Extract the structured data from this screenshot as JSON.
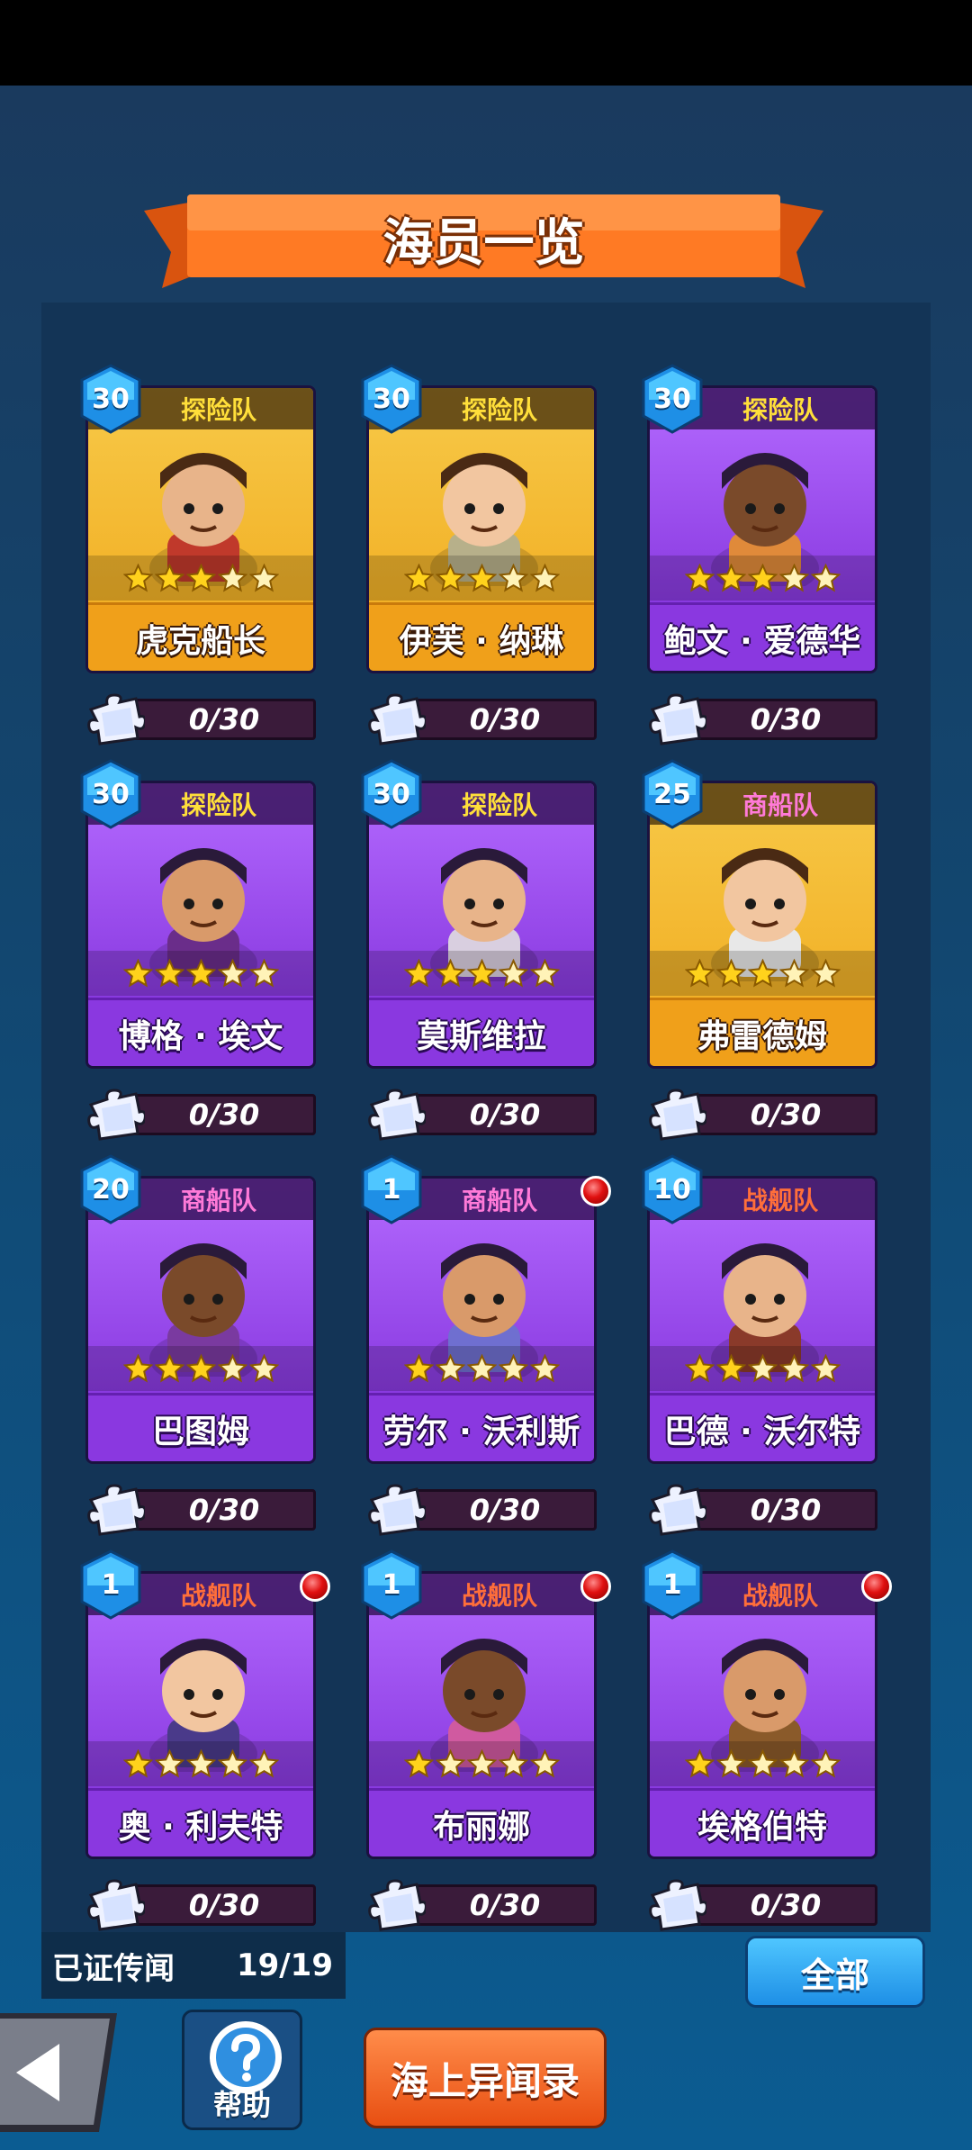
{
  "title": "海员一览",
  "crew": [
    {
      "name": "虎克船长",
      "team": "探险队",
      "team_type": "explore",
      "level": "30",
      "stars": 3,
      "theme": "gold",
      "fragments": "0/30",
      "new": false
    },
    {
      "name": "伊芙 · 纳琳",
      "team": "探险队",
      "team_type": "explore",
      "level": "30",
      "stars": 3,
      "theme": "gold",
      "fragments": "0/30",
      "new": false
    },
    {
      "name": "鲍文 · 爱德华",
      "team": "探险队",
      "team_type": "explore",
      "level": "30",
      "stars": 3,
      "theme": "purple",
      "fragments": "0/30",
      "new": false
    },
    {
      "name": "博格 · 埃文",
      "team": "探险队",
      "team_type": "explore",
      "level": "30",
      "stars": 3,
      "theme": "purple",
      "fragments": "0/30",
      "new": false
    },
    {
      "name": "莫斯维拉",
      "team": "探险队",
      "team_type": "explore",
      "level": "30",
      "stars": 3,
      "theme": "purple",
      "fragments": "0/30",
      "new": false
    },
    {
      "name": "弗雷德姆",
      "team": "商船队",
      "team_type": "merchant",
      "level": "25",
      "stars": 3,
      "theme": "gold",
      "fragments": "0/30",
      "new": false
    },
    {
      "name": "巴图姆",
      "team": "商船队",
      "team_type": "merchant",
      "level": "20",
      "stars": 3,
      "theme": "purple",
      "fragments": "0/30",
      "new": false
    },
    {
      "name": "劳尔 · 沃利斯",
      "team": "商船队",
      "team_type": "merchant",
      "level": "1",
      "stars": 1,
      "theme": "purple",
      "fragments": "0/30",
      "new": true
    },
    {
      "name": "巴德 · 沃尔特",
      "team": "战舰队",
      "team_type": "warship",
      "level": "10",
      "stars": 2,
      "theme": "purple",
      "fragments": "0/30",
      "new": false
    },
    {
      "name": "奥 · 利夫特",
      "team": "战舰队",
      "team_type": "warship",
      "level": "1",
      "stars": 1,
      "theme": "purple",
      "fragments": "0/30",
      "new": true
    },
    {
      "name": "布丽娜",
      "team": "战舰队",
      "team_type": "warship",
      "level": "1",
      "stars": 1,
      "theme": "purple",
      "fragments": "0/30",
      "new": true
    },
    {
      "name": "埃格伯特",
      "team": "战舰队",
      "team_type": "warship",
      "level": "1",
      "stars": 1,
      "theme": "purple",
      "fragments": "0/30",
      "new": true
    }
  ],
  "legend": {
    "label": "已证传闻",
    "count": "19/19"
  },
  "buttons": {
    "all": "全部",
    "help": "帮助",
    "lore": "海上异闻录"
  },
  "colors": {
    "gold_card": "#f0a01a",
    "purple_card": "#8a38e0",
    "explore": "#ffdf3a",
    "merchant": "#ff7ad8",
    "warship": "#ff6e3a"
  }
}
